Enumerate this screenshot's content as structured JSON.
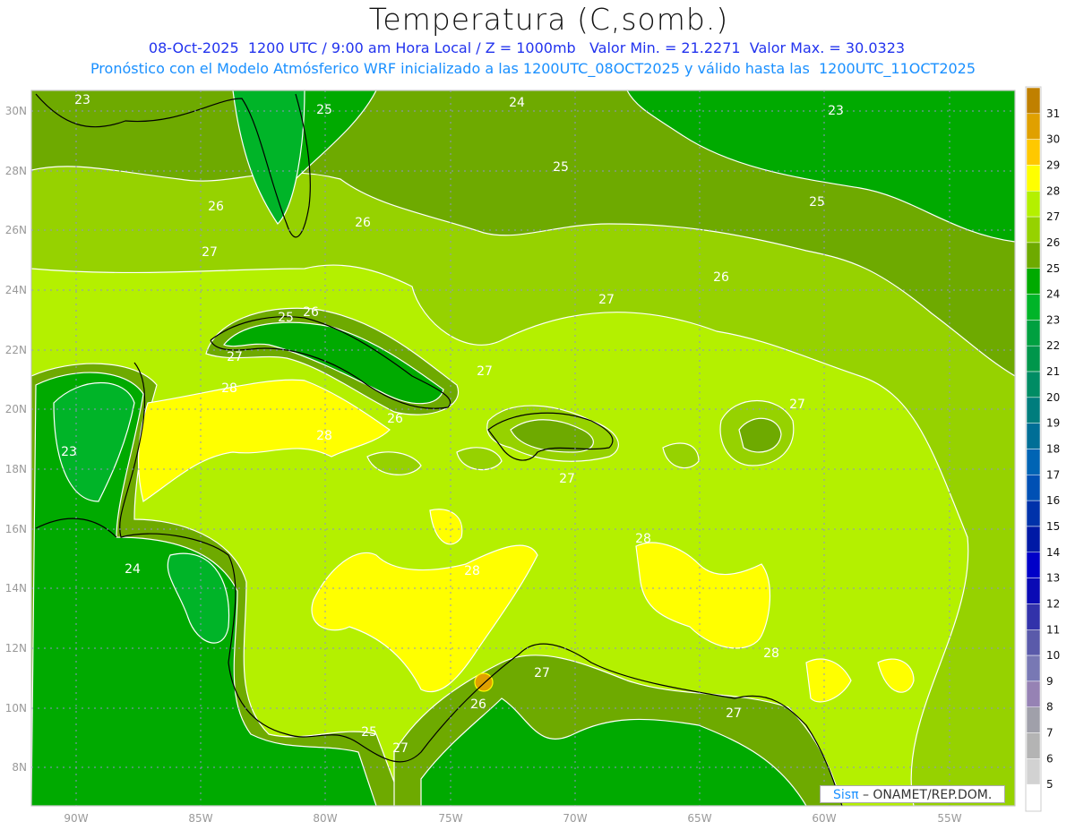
{
  "header": {
    "title": "Temperatura (C,somb.)",
    "line1": "08-Oct-2025  1200 UTC / 9:00 am Hora Local / Z = 1000mb   Valor Min. = 21.2271  Valor Max. = 30.0323",
    "line2": "Pronóstico con el Modelo Atmósferico WRF inicializado a las 1200UTC_08OCT2025 y válido hasta las  1200UTC_11OCT2025"
  },
  "axes": {
    "lon": [
      "90W",
      "85W",
      "80W",
      "75W",
      "70W",
      "65W",
      "60W",
      "55W"
    ],
    "lat": [
      "30N",
      "28N",
      "26N",
      "24N",
      "22N",
      "20N",
      "18N",
      "16N",
      "14N",
      "12N",
      "10N",
      "8N"
    ]
  },
  "colorbar": {
    "labels": [
      "31",
      "30",
      "29",
      "28",
      "27",
      "26",
      "25",
      "24",
      "23",
      "22",
      "21",
      "20",
      "19",
      "18",
      "17",
      "16",
      "15",
      "14",
      "13",
      "12",
      "11",
      "10",
      "9",
      "8",
      "7",
      "6",
      "5"
    ],
    "colors": [
      "#c08000",
      "#e0a000",
      "#ffc800",
      "#ffff00",
      "#b4f000",
      "#96d200",
      "#6eaa00",
      "#00aa00",
      "#00b428",
      "#00a040",
      "#00964b",
      "#008c64",
      "#007d7d",
      "#006e96",
      "#0064b4",
      "#0050b4",
      "#0032aa",
      "#0019a5",
      "#0000c8",
      "#0a0ab4",
      "#3232aa",
      "#5a5aaa",
      "#7878b4",
      "#9682b4",
      "#a0a0aa",
      "#b4b4b4",
      "#d2d2d2",
      "#ffffff"
    ]
  },
  "contour_labels": [
    "23",
    "25",
    "24",
    "23",
    "25",
    "26",
    "26",
    "25",
    "27",
    "26",
    "27",
    "25",
    "26",
    "27",
    "27",
    "28",
    "28",
    "26",
    "27",
    "23",
    "27",
    "28",
    "24",
    "28",
    "28",
    "27",
    "26",
    "25",
    "27",
    "27",
    "28"
  ],
  "credit": {
    "brand": "Sis",
    "pi": "π",
    "text": " – ONAMET/REP.DOM."
  }
}
